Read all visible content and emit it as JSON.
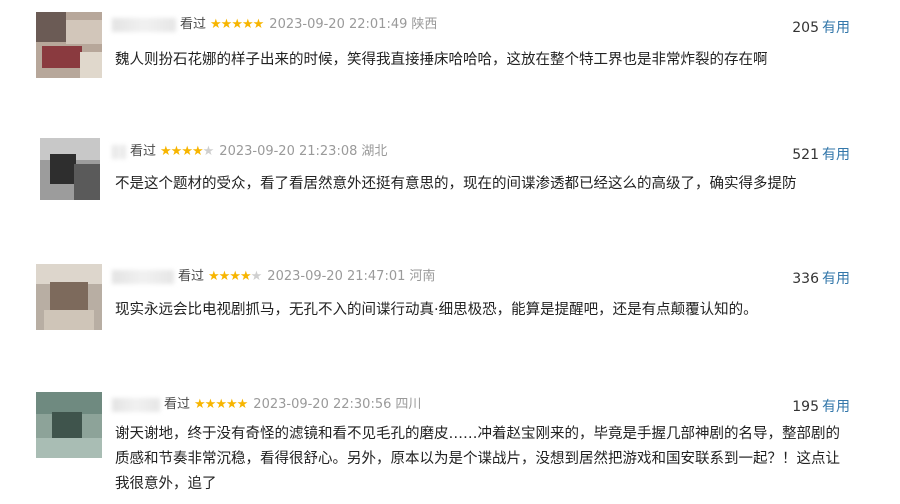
{
  "reviews": [
    {
      "seen": "看过",
      "rating": 5,
      "time": "2023-09-20 22:01:49",
      "location": "陕西",
      "votes": "205",
      "useful_label": "有用",
      "text": "魏人则扮石花娜的样子出来的时候，笑得我直接捶床哈哈哈，这放在整个特工界也是非常炸裂的存在啊",
      "avatar_color": "#b7a79a"
    },
    {
      "seen": "看过",
      "rating": 4,
      "time": "2023-09-20 21:23:08",
      "location": "湖北",
      "votes": "521",
      "useful_label": "有用",
      "text": "不是这个题材的受众，看了看居然意外还挺有意思的，现在的间谍渗透都已经这么的高级了，确实得多提防",
      "avatar_color": "#9c9c9c"
    },
    {
      "seen": "看过",
      "rating": 4,
      "time": "2023-09-20 21:47:01",
      "location": "河南",
      "votes": "336",
      "useful_label": "有用",
      "text": "现实永远会比电视剧抓马，无孔不入的间谍行动真·细思极恐，能算是提醒吧，还是有点颠覆认知的。",
      "avatar_color": "#b8aea3"
    },
    {
      "seen": "看过",
      "rating": 5,
      "time": "2023-09-20 22:30:56",
      "location": "四川",
      "votes": "195",
      "useful_label": "有用",
      "text": "谢天谢地，终于没有奇怪的滤镜和看不见毛孔的磨皮……冲着赵宝刚来的，毕竟是手握几部神剧的名导，整部剧的质感和节奏非常沉稳，看得很舒心。另外，原本以为是个谍战片，没想到居然把游戏和国安联系到一起？！这点让我很意外，追了",
      "avatar_color": "#8da399"
    }
  ]
}
